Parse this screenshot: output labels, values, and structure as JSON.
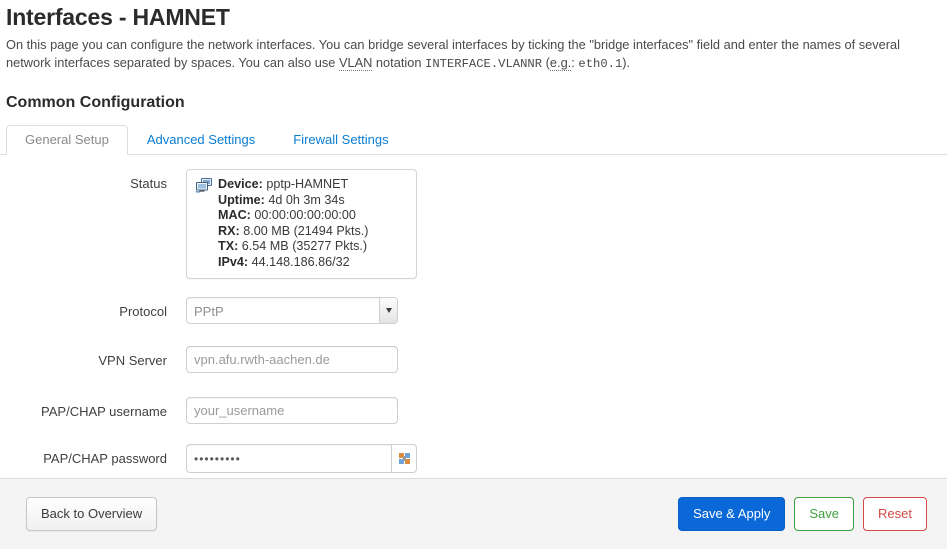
{
  "header": {
    "title": "Interfaces - HAMNET",
    "description_part1": "On this page you can configure the network interfaces. You can bridge several interfaces by ticking the \"bridge interfaces\" field and enter the names of several network interfaces separated by spaces. You can also use ",
    "description_abbr_vlan": "VLAN",
    "description_part2": " notation ",
    "description_code_vlannr": "INTERFACE.VLANNR",
    "description_part3": " (",
    "description_abbr_eg": "e.g.",
    "description_part4": ": ",
    "description_code_eth": "eth0.1",
    "description_part5": ")."
  },
  "section": {
    "title": "Common Configuration"
  },
  "tabs": [
    {
      "label": "General Setup",
      "active": true
    },
    {
      "label": "Advanced Settings",
      "active": false
    },
    {
      "label": "Firewall Settings",
      "active": false
    }
  ],
  "form": {
    "status": {
      "label": "Status",
      "icon": "network-device-icon",
      "lines": [
        {
          "key": "Device:",
          "value": "pptp-HAMNET"
        },
        {
          "key": "Uptime:",
          "value": "4d 0h 3m 34s"
        },
        {
          "key": "MAC:",
          "value": "00:00:00:00:00:00"
        },
        {
          "key": "RX:",
          "value": "8.00 MB (21494 Pkts.)"
        },
        {
          "key": "TX:",
          "value": "6.54 MB (35277 Pkts.)"
        },
        {
          "key": "IPv4:",
          "value": "44.148.186.86/32"
        }
      ]
    },
    "protocol": {
      "label": "Protocol",
      "value": "PPtP",
      "options": [
        "PPtP"
      ]
    },
    "vpn_server": {
      "label": "VPN Server",
      "value": "",
      "placeholder": "vpn.afu.rwth-aachen.de"
    },
    "pap_username": {
      "label": "PAP/CHAP username",
      "value": "",
      "placeholder": "your_username"
    },
    "pap_password": {
      "label": "PAP/CHAP password",
      "value": "•••••••••",
      "reveal_label": "*"
    }
  },
  "footer": {
    "back_label": "Back to Overview",
    "save_apply_label": "Save & Apply",
    "save_label": "Save",
    "reset_label": "Reset"
  },
  "colors": {
    "primary": "#0a68d8",
    "success": "#3fa13f",
    "danger": "#d24a45",
    "link": "#0a7dd4",
    "footer_bg": "#f4f4f4"
  }
}
